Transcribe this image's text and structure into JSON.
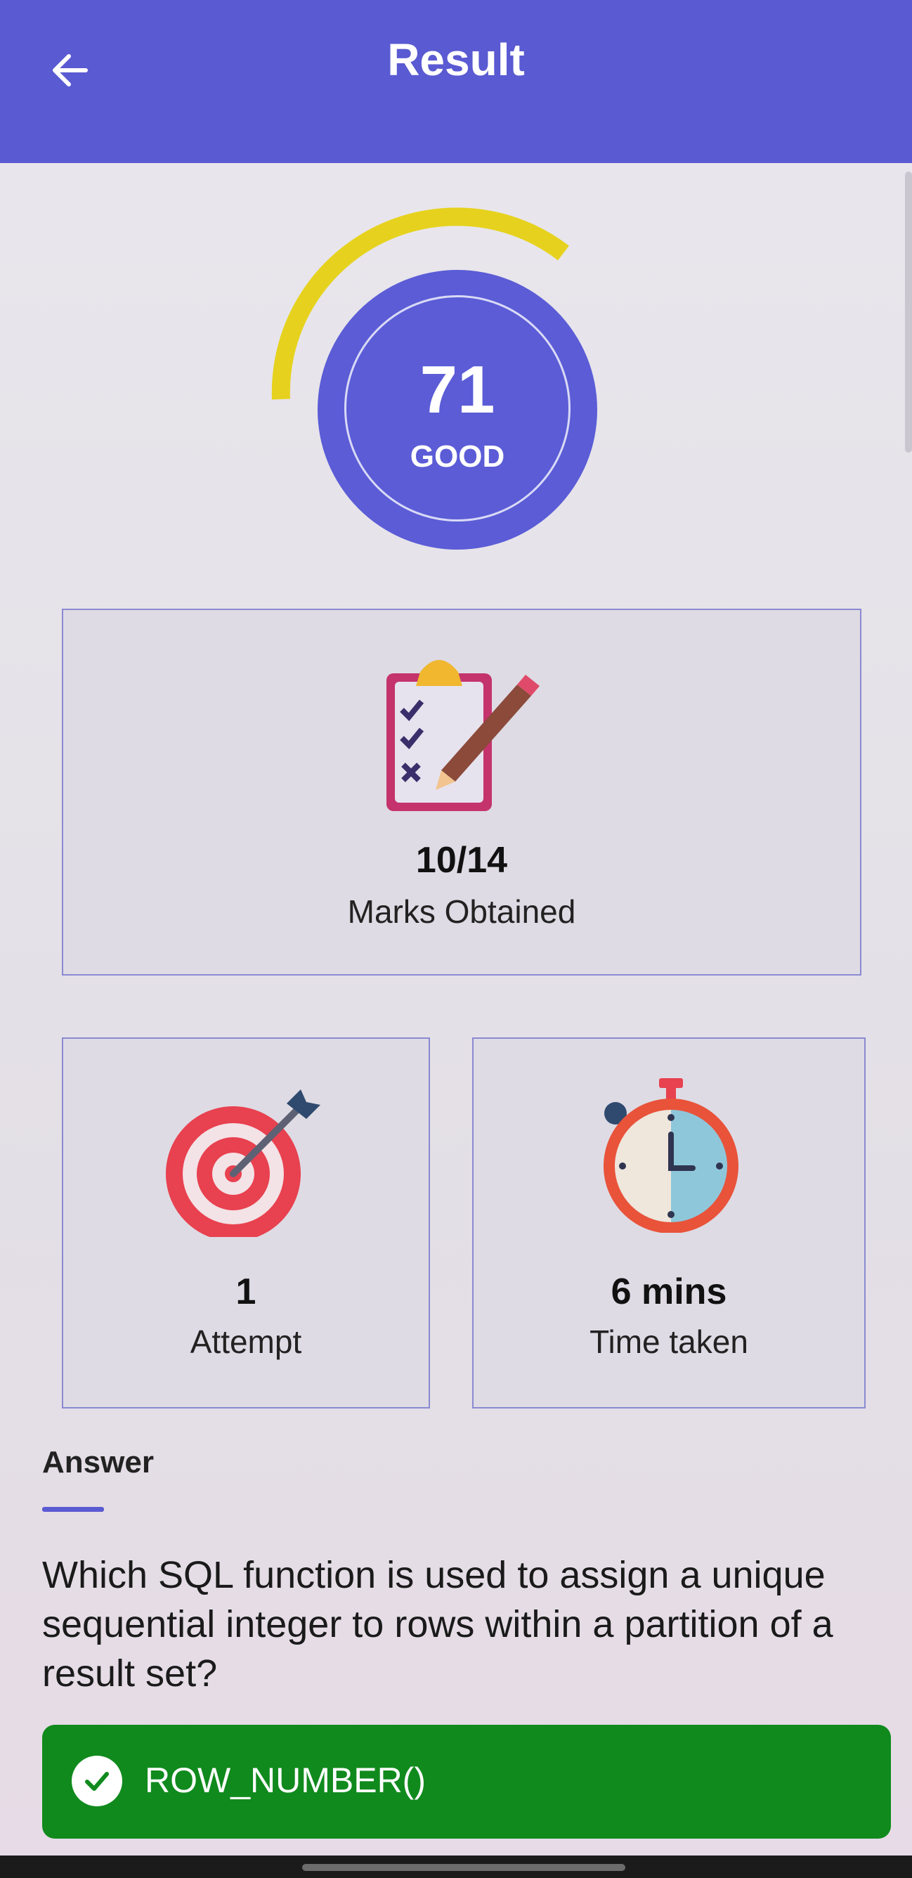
{
  "header": {
    "title": "Result",
    "back_icon": "arrow-left-icon"
  },
  "score": {
    "value": "71",
    "grade": "GOOD",
    "gauge_fraction": 0.71,
    "colors": {
      "circle": "#5b5cd6",
      "arc": "#e6d21e"
    }
  },
  "marks": {
    "value": "10/14",
    "label": "Marks Obtained",
    "icon": "clipboard-checklist-icon"
  },
  "attempts": {
    "value": "1",
    "label": "Attempt",
    "icon": "target-dart-icon"
  },
  "time": {
    "value": "6 mins",
    "label": "Time taken",
    "icon": "stopwatch-icon"
  },
  "answer": {
    "heading": "Answer",
    "question": "Which SQL function is used to assign a unique sequential integer to rows within a partition of a result set?",
    "option": "ROW_NUMBER()",
    "option_icon": "check-circle-icon",
    "option_color": "#108a1d"
  },
  "colors": {
    "accent": "#5a5ad2"
  }
}
